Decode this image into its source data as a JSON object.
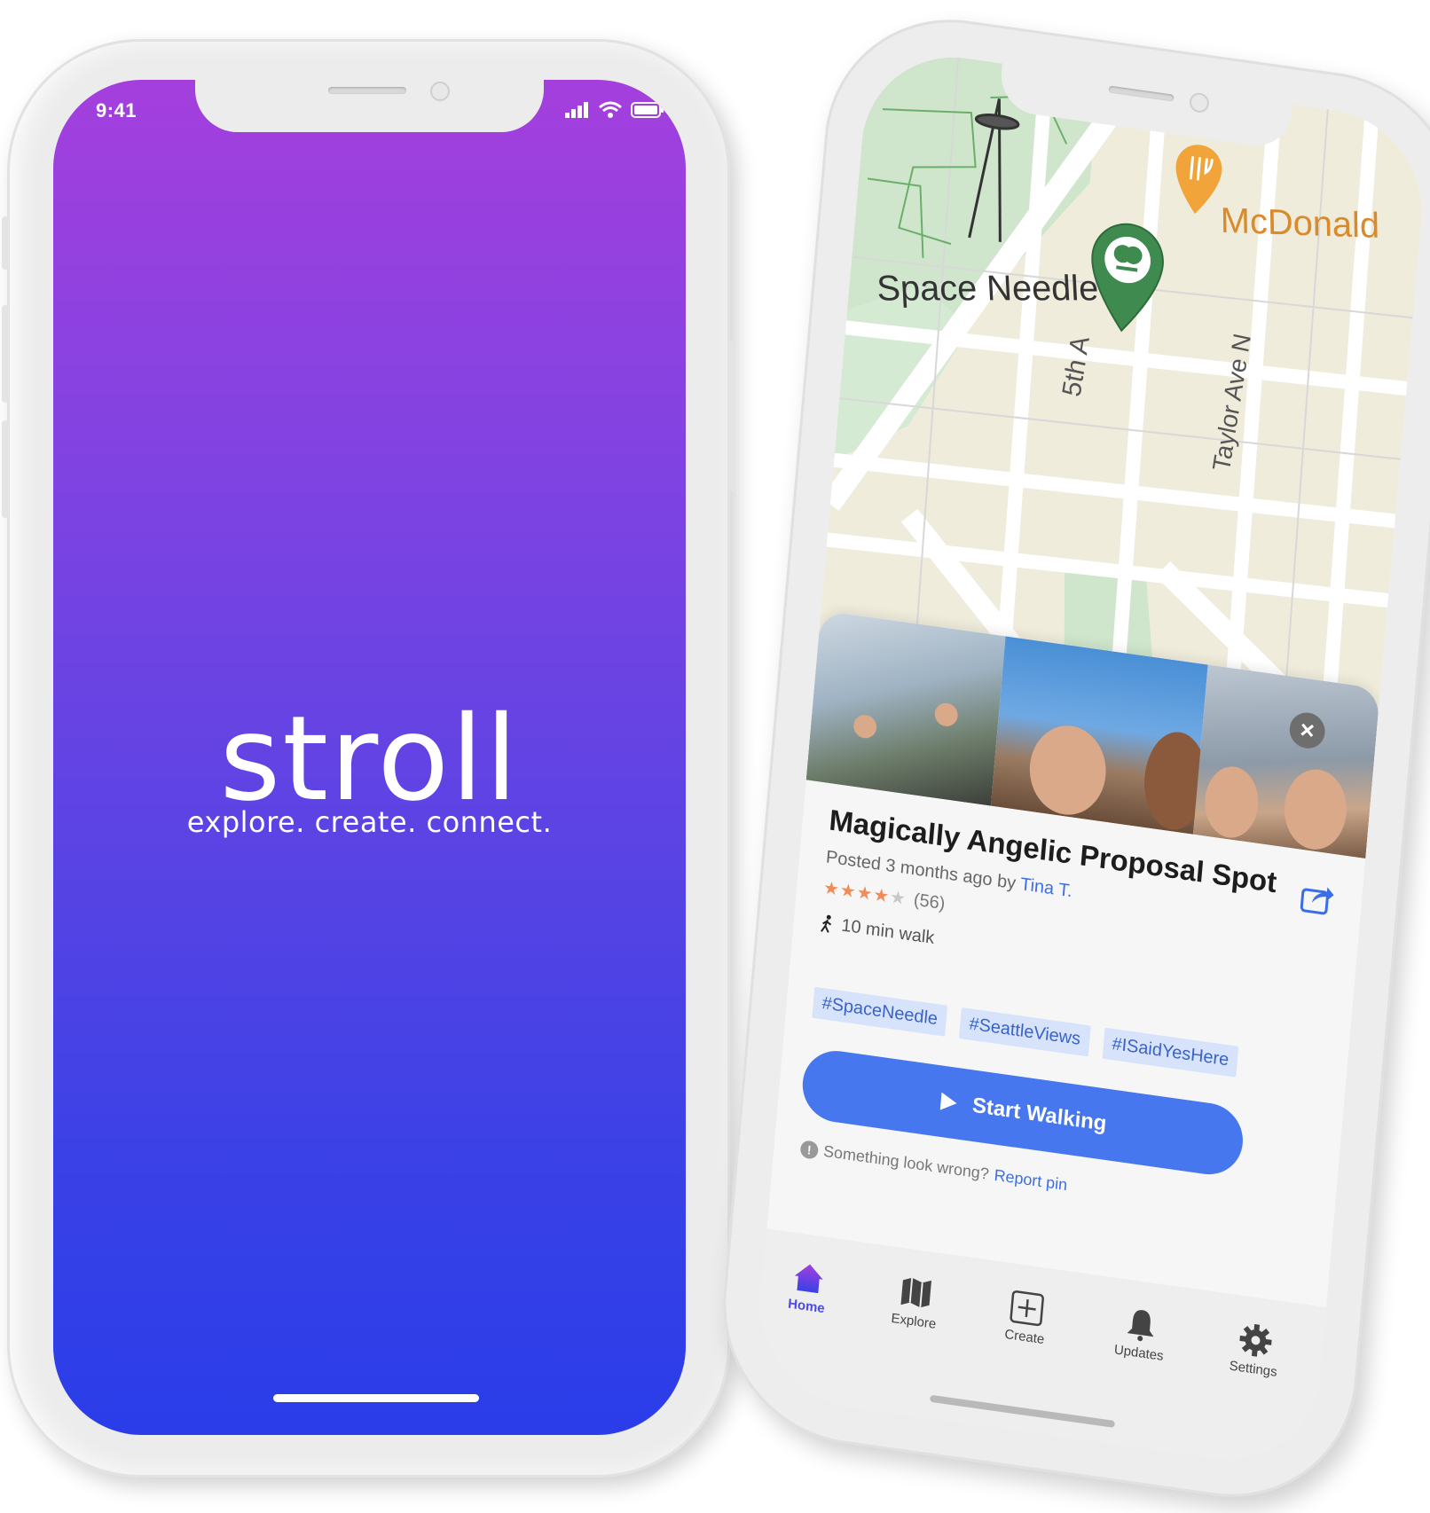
{
  "splash": {
    "status_time": "9:41",
    "logo": "stroll",
    "tagline": "explore. create. connect.",
    "gradient_top": "#a43fdd",
    "gradient_bottom": "#2a3de9"
  },
  "map": {
    "labels": {
      "space_needle": "Space Needle",
      "mcdonald": "McDonald",
      "fifth_ave": "5th A",
      "taylor_ave": "Taylor Ave N"
    },
    "pins": [
      {
        "type": "park-pin",
        "color": "#3f8a4e"
      },
      {
        "type": "restaurant-pin",
        "color": "#f0a43a"
      }
    ]
  },
  "pin_card": {
    "title": "Magically Angelic Proposal Spot",
    "posted_prefix": "Posted 3 months ago by",
    "author": "Tina T.",
    "rating_stars": 4,
    "rating_count": "(56)",
    "walk_time": "10 min walk",
    "tags": [
      "#SpaceNeedle",
      "#SeattleViews",
      "#ISaidYesHere"
    ],
    "start_button": "Start Walking",
    "report_prompt": "Something look wrong?",
    "report_link": "Report pin",
    "accent_color": "#4777ef"
  },
  "tabbar": {
    "items": [
      {
        "label": "Home",
        "icon": "home-icon",
        "active": true
      },
      {
        "label": "Explore",
        "icon": "map-icon",
        "active": false
      },
      {
        "label": "Create",
        "icon": "plus-square-icon",
        "active": false
      },
      {
        "label": "Updates",
        "icon": "bell-icon",
        "active": false
      },
      {
        "label": "Settings",
        "icon": "gear-icon",
        "active": false
      }
    ]
  }
}
